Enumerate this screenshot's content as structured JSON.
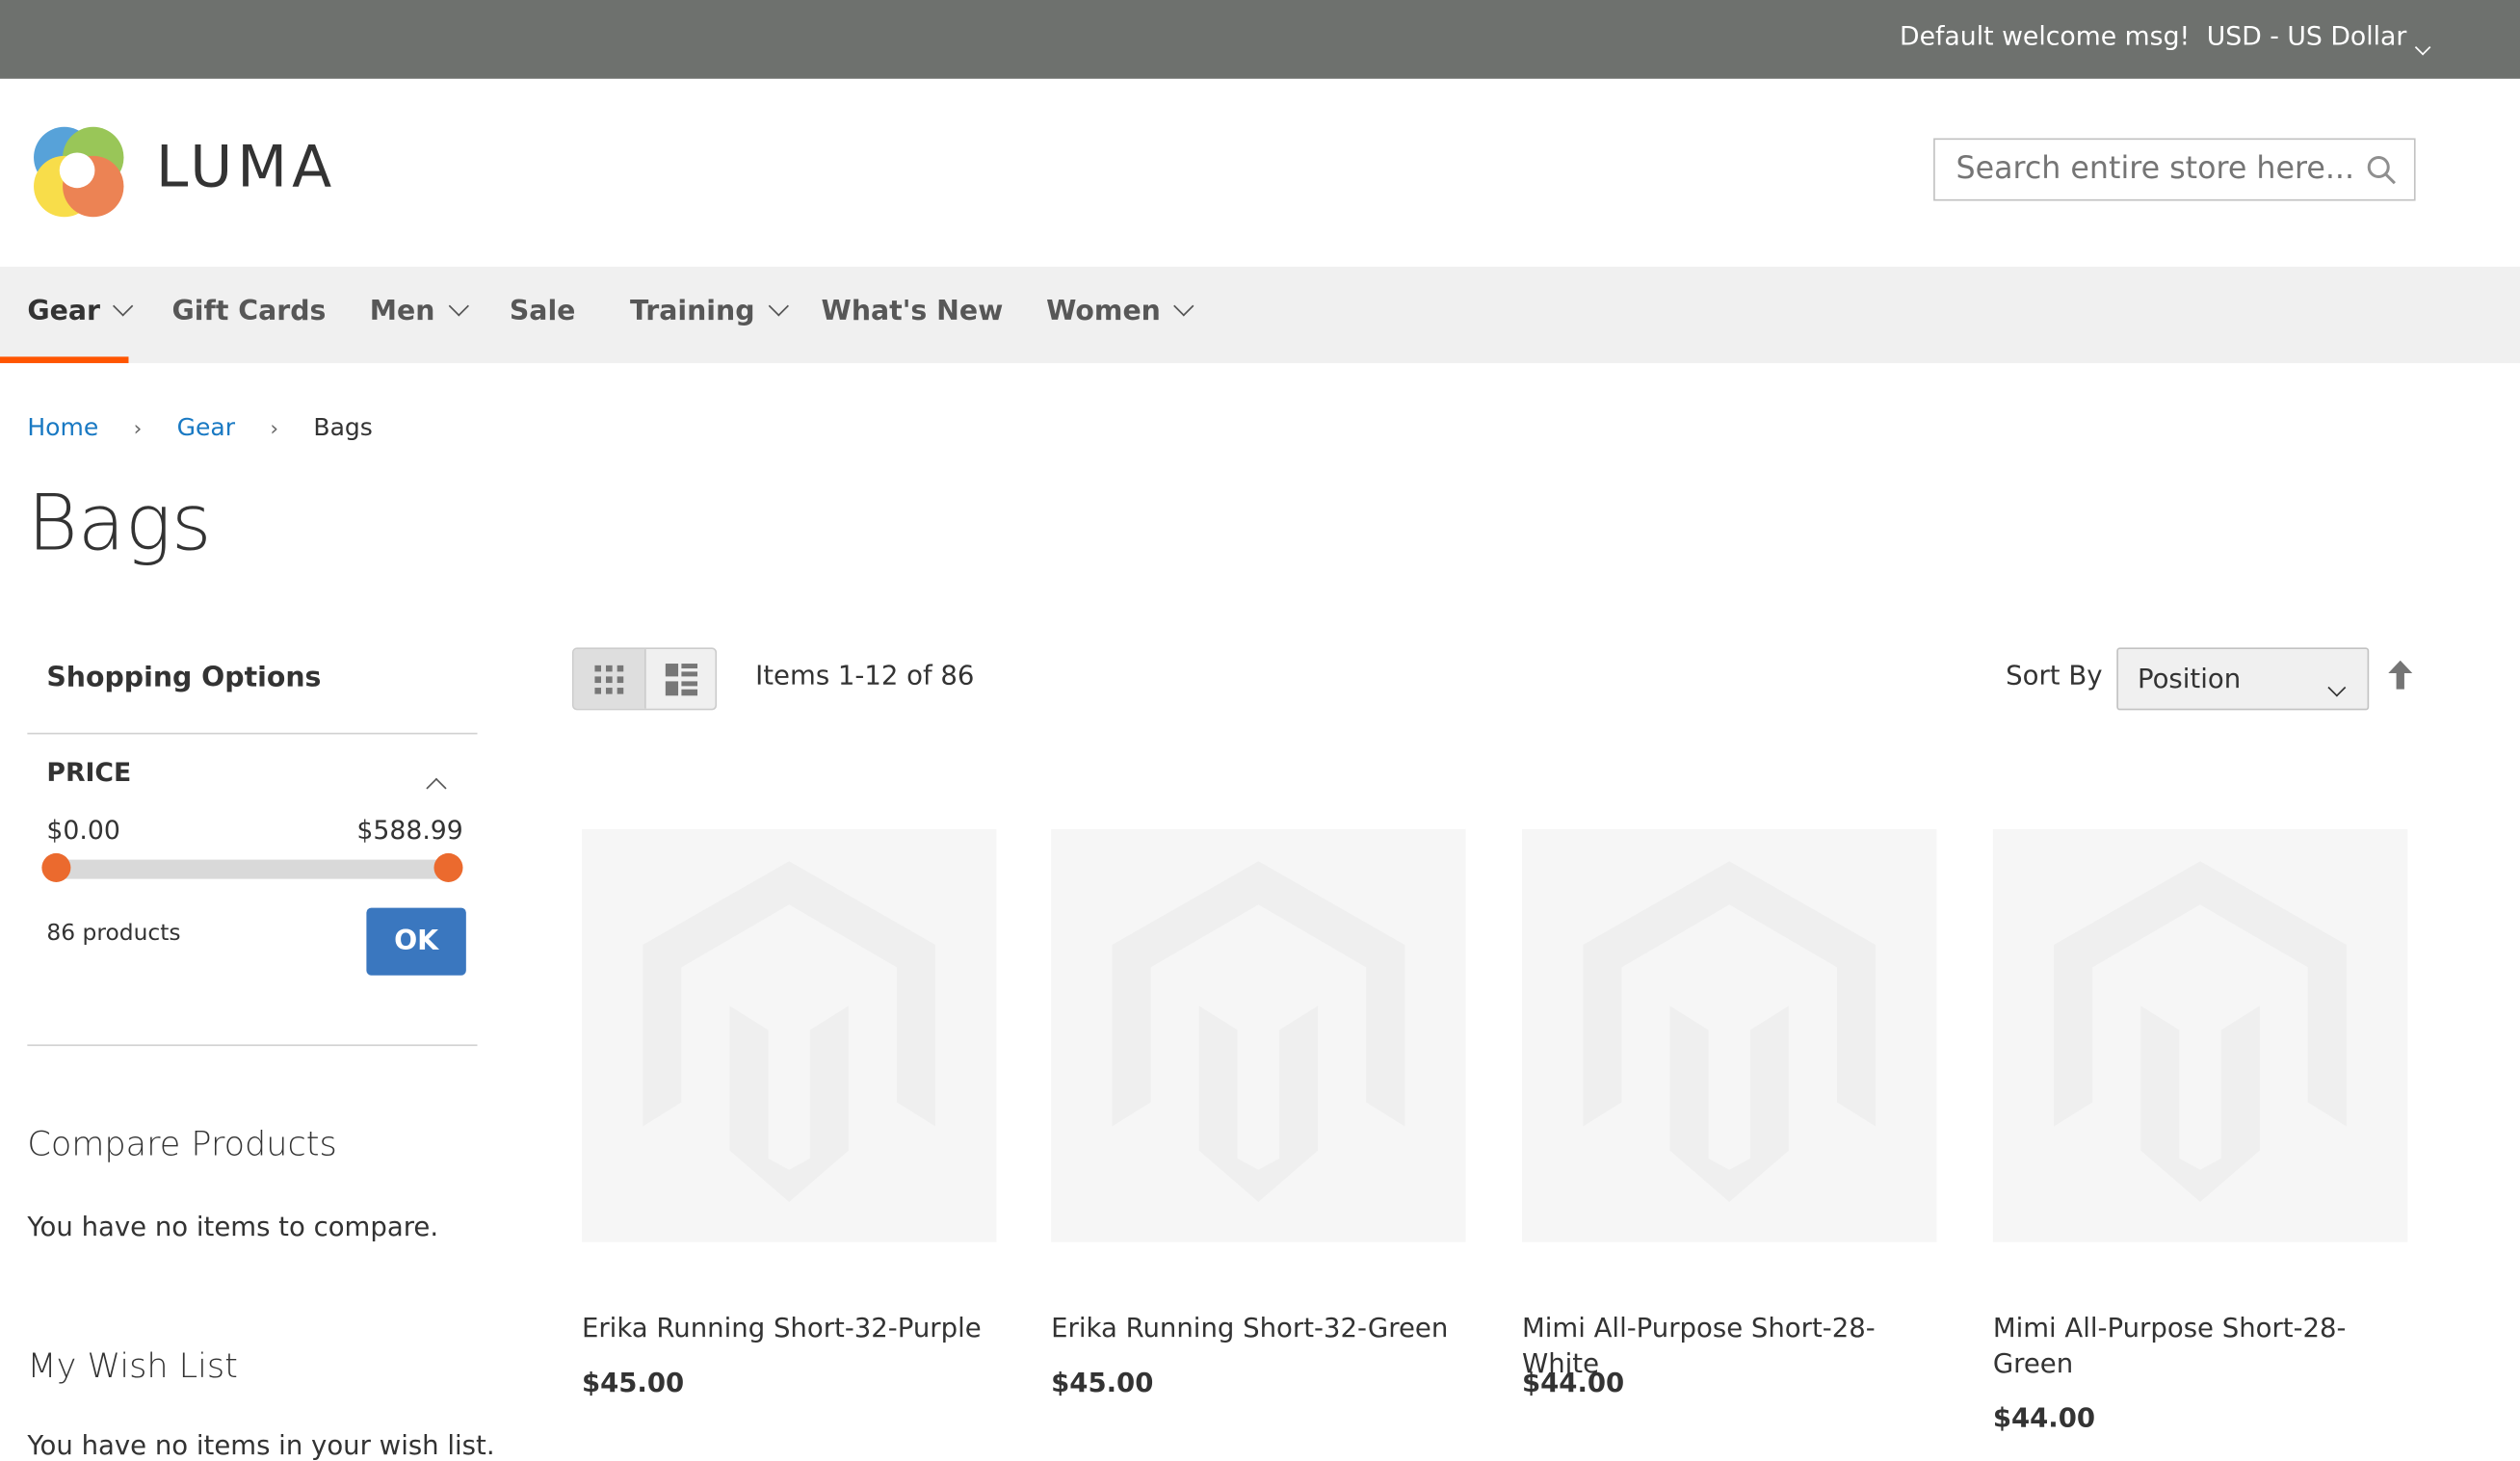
{
  "topbar": {
    "welcome": "Default welcome msg!",
    "currency": "USD - US Dollar"
  },
  "header": {
    "logo_text": "LUMA",
    "search_placeholder": "Search entire store here..."
  },
  "nav": [
    {
      "label": "Gear",
      "active": true,
      "dropdown": true
    },
    {
      "label": "Gift Cards",
      "dropdown": false
    },
    {
      "label": "Men",
      "dropdown": true
    },
    {
      "label": "Sale",
      "dropdown": false
    },
    {
      "label": "Training",
      "dropdown": true
    },
    {
      "label": "What's New",
      "dropdown": false
    },
    {
      "label": "Women",
      "dropdown": true
    }
  ],
  "breadcrumb": [
    "Home",
    "Gear",
    "Bags"
  ],
  "page_title": "Bags",
  "sidebar": {
    "title": "Shopping Options",
    "filter": {
      "label": "PRICE",
      "min": "$0.00",
      "max": "$588.99",
      "range_fraction": [
        0,
        1
      ],
      "count": "86 products",
      "ok": "OK"
    },
    "compare_title": "Compare Products",
    "compare_empty": "You have no items to compare.",
    "wishlist_title": "My Wish List",
    "wishlist_empty": "You have no items in your wish list."
  },
  "toolbar": {
    "items": "Items 1-12 of 86",
    "sort_label": "Sort By",
    "sort_value": "Position",
    "view_mode": "grid"
  },
  "products": [
    {
      "name": "Erika Running Short-32-Purple",
      "price": "$45.00"
    },
    {
      "name": "Erika Running Short-32-Green",
      "price": "$45.00"
    },
    {
      "name": "Mimi All-Purpose Short-28-White",
      "price": "$44.00"
    },
    {
      "name": "Mimi All-Purpose Short-28-Green",
      "price": "$44.00"
    }
  ],
  "colors": {
    "accent": "#ff5501",
    "button": "#3a77bf",
    "link": "#1979c3",
    "topbar": "#6e716e"
  }
}
